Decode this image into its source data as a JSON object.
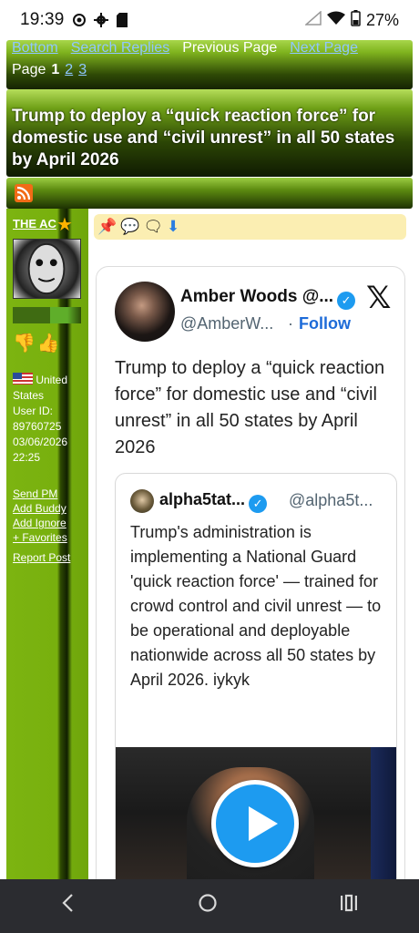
{
  "status_bar": {
    "time": "19:39",
    "battery": "27%",
    "icons": [
      "nfc-icon",
      "gear-icon",
      "sd-card-icon",
      "signal-icon",
      "wifi-icon",
      "battery-icon"
    ]
  },
  "top_nav": {
    "bottom": "Bottom",
    "search_replies": "Search Replies",
    "previous_page": "Previous Page",
    "next_page": "Next Page",
    "page_label": "Page",
    "pages": [
      "1",
      "2",
      "3"
    ],
    "current_page": "1"
  },
  "thread": {
    "title": "Trump to deploy a “quick reaction force” for domestic use and “civil unrest” in all 50 states by April 2026"
  },
  "poster": {
    "username": "THE AC",
    "country": "United States",
    "user_id_label": "User ID:",
    "user_id": "89760725",
    "date": "03/06/2026",
    "time": "22:25",
    "links": [
      "Send PM",
      "Add Buddy",
      "Add Ignore",
      "+ Favorites"
    ],
    "report": "Report Post"
  },
  "tweet": {
    "name": "Amber Woods @...",
    "handle": "@AmberW...",
    "follow": "Follow",
    "text": "Trump to deploy a “quick reaction force” for domestic use and “civil unrest” in all 50 states by April 2026",
    "quote": {
      "name": "alpha5tat...",
      "handle": "@alpha5t...",
      "text": "Trump's administration is implementing a National Guard 'quick reaction force' — trained for crowd control and civil unrest — to be operational and deployable nationwide across all 50 states by April 2026. iykyk"
    }
  },
  "colors": {
    "forum_green": "#7cb411",
    "link_blue": "#8fc7ff",
    "twitter_blue": "#1d9bf0"
  }
}
